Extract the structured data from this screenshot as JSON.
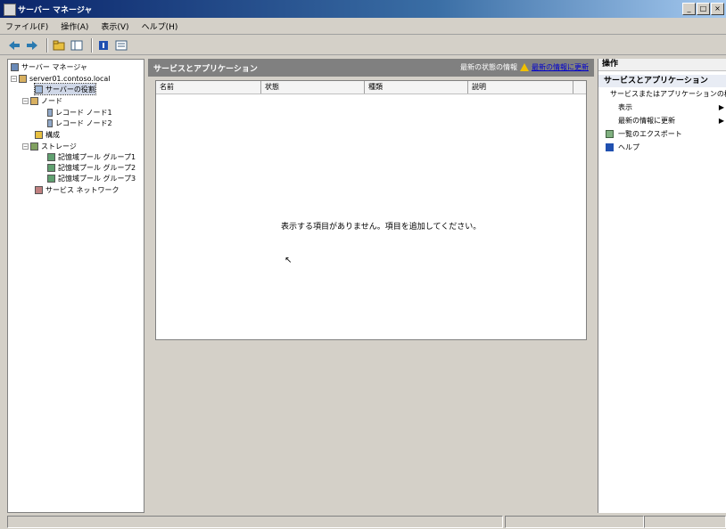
{
  "window": {
    "title": "サーバー マネージャ",
    "icon": "server-manager-icon",
    "buttons": [
      "_",
      "□",
      "×"
    ]
  },
  "menu": [
    "ファイル(F)",
    "操作(A)",
    "表示(V)",
    "ヘルプ(H)"
  ],
  "toolbar": {
    "icons": [
      "back-arrow-icon",
      "forward-arrow-icon",
      "folder-up-icon",
      "console-tree-icon",
      "help-icon",
      "properties-icon"
    ]
  },
  "tree": {
    "root": "サーバー マネージャ",
    "server": "server01.contoso.local",
    "items": [
      {
        "label": "サーバーの役割",
        "level": 2,
        "icon": "roles-icon"
      },
      {
        "label": "ノード",
        "level": 1,
        "icon": "node-icon"
      },
      {
        "label": "レコード ノード1",
        "level": 3,
        "icon": "record-icon"
      },
      {
        "label": "レコード ノード2",
        "level": 3,
        "icon": "record-icon"
      },
      {
        "label": "構成",
        "level": 1,
        "icon": "config-icon"
      },
      {
        "label": "ストレージ",
        "level": 1,
        "icon": "storage-icon"
      },
      {
        "label": "記憶域プール グループ1",
        "level": 2,
        "icon": "storage-icon"
      },
      {
        "label": "記憶域プール グループ2",
        "level": 2,
        "icon": "storage-icon"
      },
      {
        "label": "記憶域プール グループ3",
        "level": 2,
        "icon": "storage-icon"
      },
      {
        "label": "サービス ネットワーク",
        "level": 1,
        "icon": "network-icon"
      }
    ]
  },
  "center": {
    "header_title": "サービスとアプリケーション",
    "header_status": "最新の状態の情報",
    "header_warning_link": "最新の情報に更新",
    "columns": [
      "名前",
      "状態",
      "種類",
      "説明"
    ],
    "empty_message": "表示する項目がありません。項目を追加してください。",
    "cursor": "↖"
  },
  "actions": {
    "header": "操作",
    "section": "サービスとアプリケーション",
    "items": [
      {
        "label": "サービスまたはアプリケーションの構成",
        "icon": "configure-icon",
        "has_arrow": false
      },
      {
        "label": "表示",
        "icon": "",
        "has_arrow": true
      },
      {
        "label": "最新の情報に更新",
        "icon": "",
        "has_arrow": true
      },
      {
        "label": "一覧のエクスポート",
        "icon": "export-icon",
        "has_arrow": false
      },
      {
        "label": "ヘルプ",
        "icon": "help-icon",
        "has_arrow": false
      }
    ]
  }
}
